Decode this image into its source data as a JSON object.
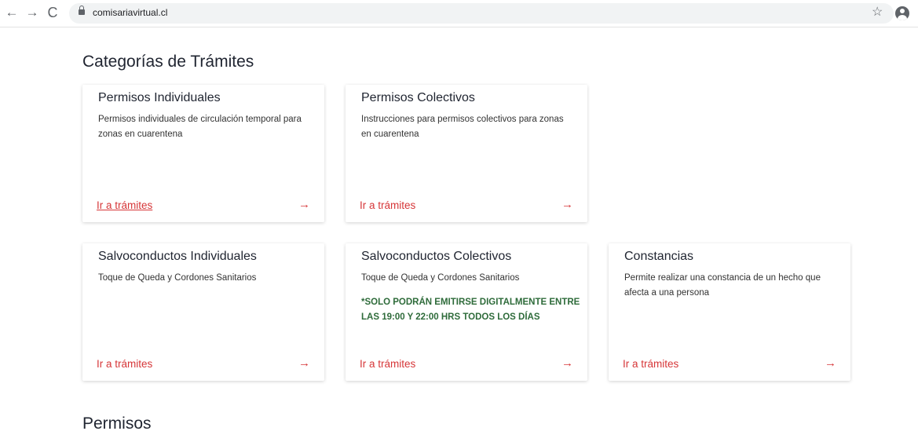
{
  "browser": {
    "back_icon": "←",
    "forward_icon": "→",
    "reload_icon": "C",
    "url": "comisariavirtual.cl",
    "star_icon": "☆"
  },
  "page": {
    "section_categories": "Categorías de Trámites",
    "section_permisos": "Permisos",
    "arrow": "→",
    "cards": [
      {
        "title": "Permisos Individuales",
        "description": "Permisos individuales de circulación temporal para zonas en cuarentena",
        "link": "Ir a trámites"
      },
      {
        "title": "Permisos Colectivos",
        "description": "Instrucciones para permisos colectivos para zonas en cuarentena",
        "link": "Ir a trámites"
      },
      {
        "title": "Salvoconductos Individuales",
        "description": "Toque de Queda y Cordones Sanitarios",
        "link": "Ir a trámites"
      },
      {
        "title": "Salvoconductos Colectivos",
        "description": "Toque de Queda y Cordones Sanitarios",
        "notice": "*SOLO PODRÁN EMITIRSE DIGITALMENTE ENTRE LAS 19:00 Y 22:00 HRS TODOS LOS DÍAS",
        "link": "Ir a trámites"
      },
      {
        "title": "Constancias",
        "description": "Permite realizar una constancia de un hecho que afecta a una persona",
        "link": "Ir a trámites"
      }
    ]
  },
  "colors": {
    "link": "#d63638",
    "notice": "#2e6b3a",
    "title": "#1f2430"
  }
}
